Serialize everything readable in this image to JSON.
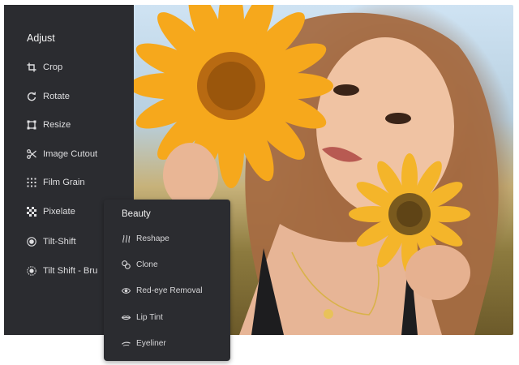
{
  "adjust": {
    "title": "Adjust",
    "items": [
      {
        "label": "Crop",
        "icon": "crop-icon"
      },
      {
        "label": "Rotate",
        "icon": "rotate-icon"
      },
      {
        "label": "Resize",
        "icon": "resize-icon"
      },
      {
        "label": "Image Cutout",
        "icon": "scissors-icon"
      },
      {
        "label": "Film Grain",
        "icon": "grain-icon"
      },
      {
        "label": "Pixelate",
        "icon": "pixelate-icon"
      },
      {
        "label": "Tilt-Shift",
        "icon": "tilt-shift-icon"
      },
      {
        "label": "Tilt Shift - Bru",
        "icon": "tilt-shift-brush-icon"
      }
    ]
  },
  "beauty": {
    "title": "Beauty",
    "items": [
      {
        "label": "Reshape",
        "icon": "reshape-icon"
      },
      {
        "label": "Clone",
        "icon": "clone-icon"
      },
      {
        "label": "Red-eye Removal",
        "icon": "eye-icon"
      },
      {
        "label": "Lip Tint",
        "icon": "lips-icon"
      },
      {
        "label": "Eyeliner",
        "icon": "eyeliner-icon"
      }
    ]
  },
  "colors": {
    "panel_bg": "#2b2c30",
    "text": "#dedee0",
    "petal": "#f6a81c",
    "flower_center": "#b86a12"
  }
}
